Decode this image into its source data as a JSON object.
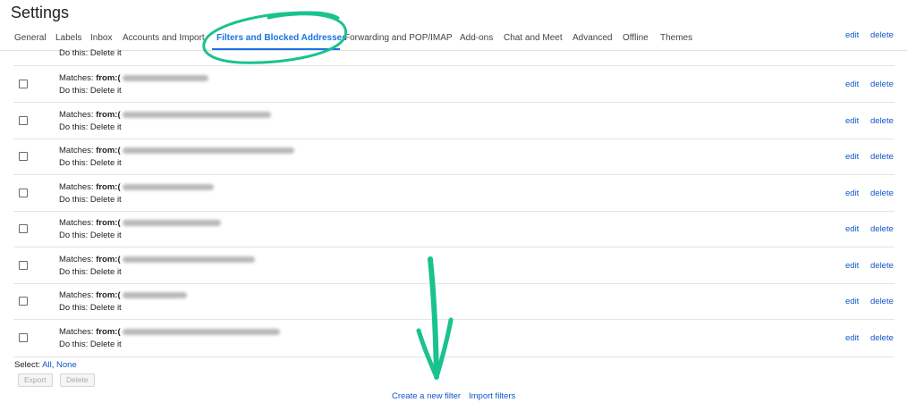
{
  "page_title": "Settings",
  "tabs": [
    {
      "label": "General"
    },
    {
      "label": "Labels"
    },
    {
      "label": "Inbox"
    },
    {
      "label": "Accounts and Import"
    },
    {
      "label": "Filters and Blocked Addresses",
      "active": true
    },
    {
      "label": "Forwarding and POP/IMAP"
    },
    {
      "label": "Add-ons"
    },
    {
      "label": "Chat and Meet"
    },
    {
      "label": "Advanced"
    },
    {
      "label": "Offline"
    },
    {
      "label": "Themes"
    }
  ],
  "filters": {
    "partial_row": {
      "action": "Do this: Delete it",
      "edit": "edit",
      "delete": "delete"
    },
    "rows": [
      {
        "matches_label": "Matches: ",
        "from_label": "from:(",
        "action": "Do this: Delete it",
        "edit": "edit",
        "delete": "delete"
      },
      {
        "matches_label": "Matches: ",
        "from_label": "from:(",
        "action": "Do this: Delete it",
        "edit": "edit",
        "delete": "delete"
      },
      {
        "matches_label": "Matches: ",
        "from_label": "from:(",
        "action": "Do this: Delete it",
        "edit": "edit",
        "delete": "delete"
      },
      {
        "matches_label": "Matches: ",
        "from_label": "from:(",
        "action": "Do this: Delete it",
        "edit": "edit",
        "delete": "delete"
      },
      {
        "matches_label": "Matches: ",
        "from_label": "from:(",
        "action": "Do this: Delete it",
        "edit": "edit",
        "delete": "delete"
      },
      {
        "matches_label": "Matches: ",
        "from_label": "from:(",
        "action": "Do this: Delete it",
        "edit": "edit",
        "delete": "delete"
      },
      {
        "matches_label": "Matches: ",
        "from_label": "from:(",
        "action": "Do this: Delete it",
        "edit": "edit",
        "delete": "delete"
      },
      {
        "matches_label": "Matches: ",
        "from_label": "from:(",
        "action": "Do this: Delete it",
        "edit": "edit",
        "delete": "delete"
      }
    ]
  },
  "select": {
    "label": "Select: ",
    "all": "All",
    "separator": ", ",
    "none": "None"
  },
  "buttons": {
    "export": "Export",
    "delete": "Delete"
  },
  "footer": {
    "create_filter": "Create a new filter",
    "import_filters": "Import filters"
  },
  "colors": {
    "link": "#1155cc",
    "active_tab": "#1a73e8",
    "annotation": "#19c28e"
  }
}
